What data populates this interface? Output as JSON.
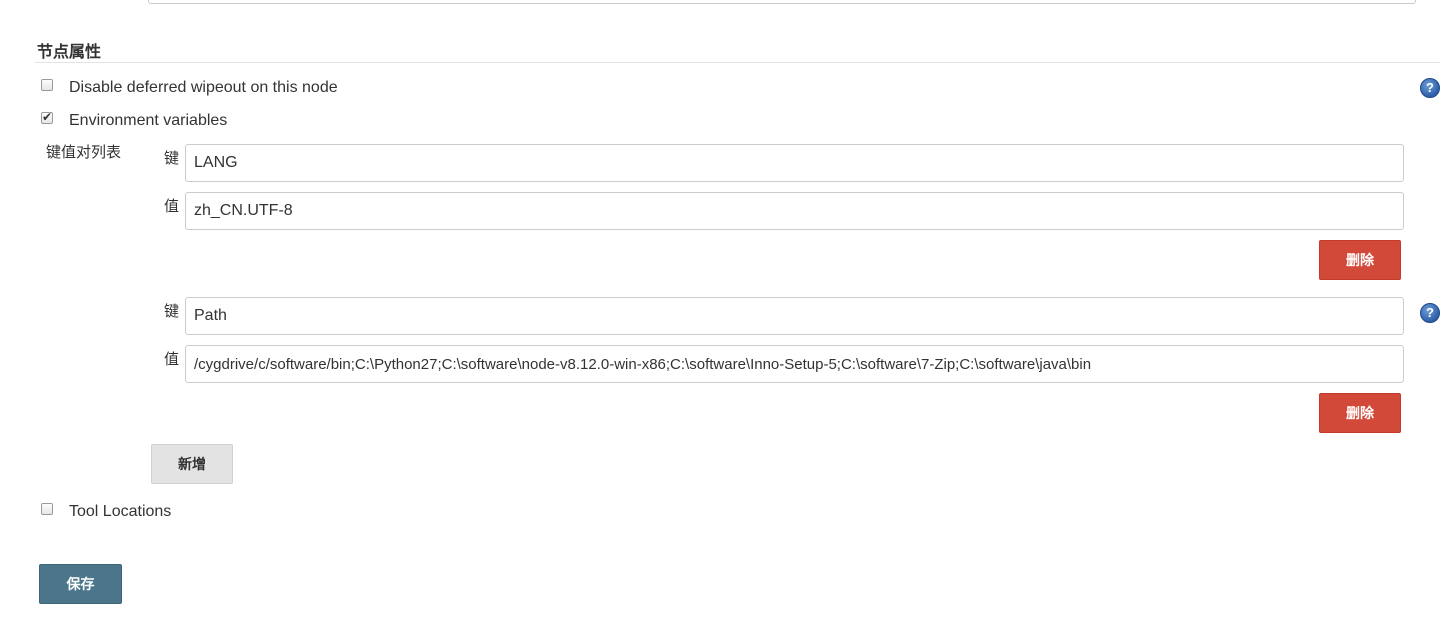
{
  "section": {
    "title": "节点属性"
  },
  "options": {
    "disable_wipeout_label": "Disable deferred wipeout on this node",
    "disable_wipeout_checked": false,
    "env_vars_label": "Environment variables",
    "env_vars_checked": true,
    "tool_locations_label": "Tool Locations",
    "tool_locations_checked": false
  },
  "env": {
    "caption": "键值对列表",
    "key_label": "键",
    "value_label": "值",
    "entries": [
      {
        "key": "LANG",
        "value": "zh_CN.UTF-8",
        "delete_label": "删除"
      },
      {
        "key": "Path",
        "value": "/cygdrive/c/software/bin;C:\\Python27;C:\\software\\node-v8.12.0-win-x86;C:\\software\\Inno-Setup-5;C:\\software\\7-Zip;C:\\software\\java\\bin",
        "delete_label": "删除"
      }
    ],
    "add_label": "新增"
  },
  "help": {
    "symbol": "?"
  },
  "actions": {
    "save_label": "保存"
  },
  "colors": {
    "delete_button": "#d24939",
    "save_button": "#4b758b",
    "add_button": "#e3e3e3",
    "help_icon": "#2c5fa8"
  }
}
